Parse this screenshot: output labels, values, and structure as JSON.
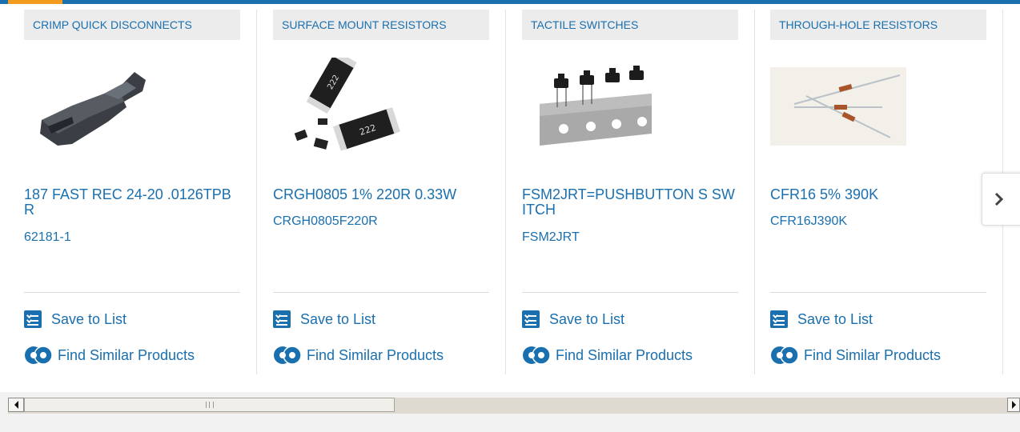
{
  "colors": {
    "link": "#1a6fae",
    "accent": "#f39b1f",
    "category_bg": "#ececec"
  },
  "cards": [
    {
      "category": "CRIMP QUICK DISCONNECTS",
      "name": "187 FAST REC 24-20 .0126TPBR",
      "part_number": "62181-1",
      "image_icon": "crimp-connector-image"
    },
    {
      "category": "SURFACE MOUNT RESISTORS",
      "name": "CRGH0805 1% 220R 0.33W",
      "part_number": "CRGH0805F220R",
      "image_icon": "smd-resistor-image",
      "image_marking": "222"
    },
    {
      "category": "TACTILE SWITCHES",
      "name": "FSM2JRT=PUSHBUTTON S SWITCH",
      "part_number": "FSM2JRT",
      "image_icon": "tactile-switch-image"
    },
    {
      "category": "THROUGH-HOLE RESISTORS",
      "name": "CFR16 5% 390K",
      "part_number": "CFR16J390K",
      "image_icon": "through-hole-resistor-image"
    }
  ],
  "actions": {
    "save_label": "Save to List",
    "similar_label": "Find Similar Products"
  },
  "navigation": {
    "next_icon": "chevron-right-icon"
  },
  "scrollbar": {
    "left_icon": "arrow-left-icon",
    "right_icon": "arrow-right-icon"
  }
}
